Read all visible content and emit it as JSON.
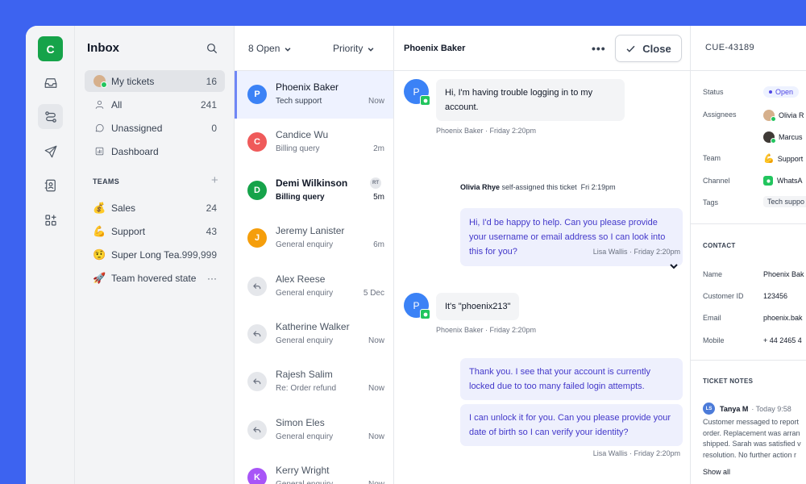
{
  "rail": {
    "workspace_initial": "C",
    "icons": [
      "inbox-icon",
      "tickets-icon",
      "send-icon",
      "contacts-icon",
      "apps-icon"
    ]
  },
  "sidebar": {
    "title": "Inbox",
    "items": [
      {
        "label": "My tickets",
        "count": "16"
      },
      {
        "label": "All",
        "count": "241"
      },
      {
        "label": "Unassigned",
        "count": "0"
      },
      {
        "label": "Dashboard",
        "count": ""
      }
    ],
    "teams_header": "TEAMS",
    "teams_add": "+",
    "teams": [
      {
        "emoji": "💰",
        "label": "Sales",
        "count": "24"
      },
      {
        "emoji": "💪",
        "label": "Support",
        "count": "43"
      },
      {
        "emoji": "🤨",
        "label": "Super Long Tea...",
        "count": "999,999"
      },
      {
        "emoji": "🚀",
        "label": "Team hovered state",
        "count": "···"
      }
    ]
  },
  "list": {
    "filter_status": "8 Open",
    "filter_sort": "Priority",
    "tickets": [
      {
        "initial": "P",
        "color": "#3B82F6",
        "name": "Phoenix Baker",
        "subject": "Tech support",
        "time": "Now"
      },
      {
        "initial": "C",
        "color": "#EF5A5A",
        "name": "Candice Wu",
        "subject": "Billing query",
        "time": "2m"
      },
      {
        "initial": "D",
        "color": "#16A34A",
        "name": "Demi Wilkinson",
        "subject": "Billing query",
        "time": "5m",
        "badge": "RT"
      },
      {
        "initial": "J",
        "color": "#F59E0B",
        "name": "Jeremy Lanister",
        "subject": "General enquiry",
        "time": "6m"
      },
      {
        "initial": "",
        "color": "#E5E7EB",
        "name": "Alex Reese",
        "subject": "General enquiry",
        "time": "5 Dec"
      },
      {
        "initial": "",
        "color": "#E5E7EB",
        "name": "Katherine Walker",
        "subject": "General enquiry",
        "time": "Now"
      },
      {
        "initial": "",
        "color": "#E5E7EB",
        "name": "Rajesh Salim",
        "subject": "Re: Order refund",
        "time": "Now"
      },
      {
        "initial": "",
        "color": "#E5E7EB",
        "name": "Simon Eles",
        "subject": "General enquiry",
        "time": "Now"
      },
      {
        "initial": "K",
        "color": "#A855F7",
        "name": "Kerry Wright",
        "subject": "General enquiry",
        "time": "Now"
      }
    ]
  },
  "conversation": {
    "title": "Phoenix Baker",
    "more": "•••",
    "close_label": "Close",
    "messages": [
      {
        "initial": "P",
        "text": "Hi, I'm having trouble logging in to my account.",
        "meta": "Phoenix Baker · Friday 2:20pm"
      },
      {
        "text": "Hi, I'd be happy to help. Can you please provide your username or email address so I can look into this for you?",
        "meta": "Lisa Wallis · Friday 2:20pm"
      },
      {
        "initial": "P",
        "text": "It's \"phoenix213\"",
        "meta": "Phoenix Baker · Friday 2:20pm"
      },
      {
        "text": "Thank you. I see that your account is currently locked due to too many failed login attempts."
      },
      {
        "text": "I can unlock it for you. Can you please provide your date of birth so I can verify your identity?",
        "meta": "Lisa Wallis · Friday 2:20pm"
      }
    ],
    "system": {
      "actor": "Olivia Rhye",
      "action": "self-assigned this ticket",
      "time": "Fri 2:19pm"
    }
  },
  "details": {
    "ticket_id": "CUE-43189",
    "status_label": "Status",
    "status_value": "Open",
    "assignees_label": "Assignees",
    "assignees": [
      "Olivia R",
      "Marcus"
    ],
    "team_label": "Team",
    "team_value": "Support",
    "channel_label": "Channel",
    "channel_value": "WhatsA",
    "tags_label": "Tags",
    "tags_value": "Tech suppo",
    "contact_header": "CONTACT",
    "contact": [
      {
        "label": "Name",
        "value": "Phoenix Bak"
      },
      {
        "label": "Customer ID",
        "value": "123456"
      },
      {
        "label": "Email",
        "value": "phoenix.bak"
      },
      {
        "label": "Mobile",
        "value": "+ 44 2465 4"
      }
    ],
    "notes_header": "TICKET NOTES",
    "note": {
      "initials": "LS",
      "author": "Tanya M",
      "time": "· Today 9:58",
      "lines": [
        "Customer messaged to report",
        "order. Replacement was arran",
        "shipped. Sarah was satisfied v",
        "resolution. No further action r"
      ]
    },
    "show_all": "Show all"
  },
  "colors": {
    "background": "#3D63F0",
    "accent": "#16A34A",
    "selected": "#EEF2FF",
    "outgoing": "#EEF0FD"
  }
}
